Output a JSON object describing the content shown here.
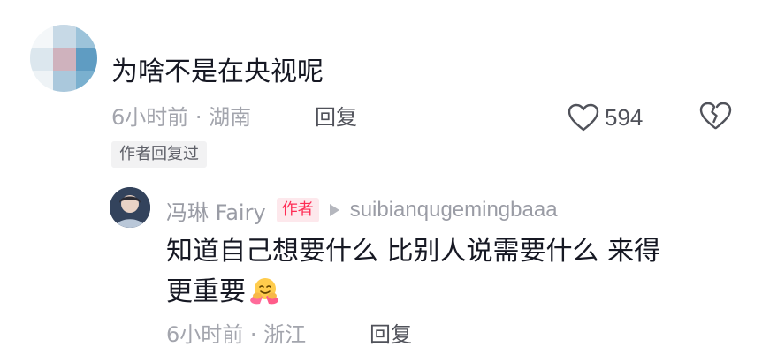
{
  "comment": {
    "text": "为啥不是在央视呢",
    "meta": "6小时前 · 湖南",
    "reply_label": "回复",
    "like_count": "594",
    "author_replied_tag": "作者回复过",
    "avatar_colors": [
      "#e3eef5",
      "#b9d2e3",
      "#7fb0cf",
      "#d9c9d2",
      "#c2a1ad",
      "#f1f5f7"
    ]
  },
  "reply": {
    "username": "冯琳 Fairy",
    "author_badge": "作者",
    "reply_to": "suibianqugemingbaaa",
    "text_line1": "知道自己想要什么 比别人说需要什么 来得",
    "text_line2": "更重要",
    "emoji": "hugging-face-icon",
    "meta": "6小时前 · 浙江",
    "reply_label": "回复"
  },
  "colors": {
    "text_primary": "#161823",
    "text_secondary": "#a3a5ad",
    "accent": "#fe2c55"
  }
}
